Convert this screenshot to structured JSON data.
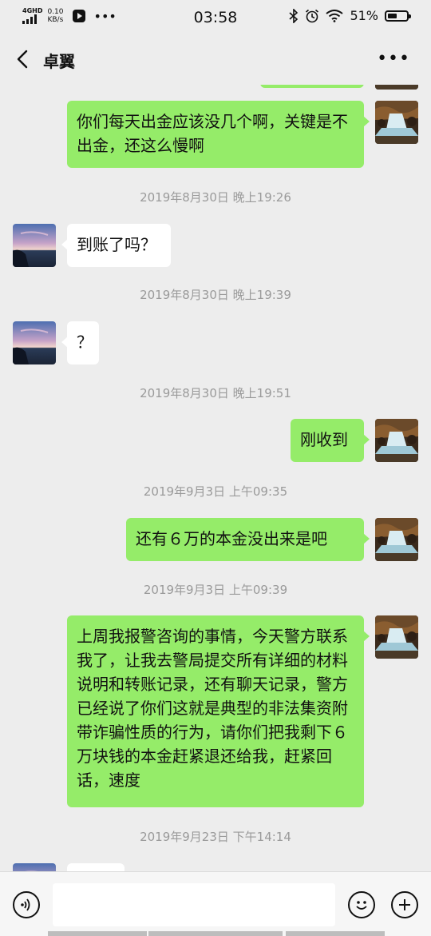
{
  "status_bar": {
    "network_tag": "4GHD",
    "speed_value": "0.10",
    "speed_unit": "KB/s",
    "time": "03:58",
    "battery_pct": "51%",
    "battery_level": 0.51
  },
  "header": {
    "title": "卓翼"
  },
  "messages": [
    {
      "sender": "me",
      "text": "你们每天出金应该没几个啊，关键是不出金，还这么慢啊"
    },
    {
      "timestamp": "2019年8月30日 晚上19:26"
    },
    {
      "sender": "them",
      "text": "到账了吗？"
    },
    {
      "timestamp": "2019年8月30日 晚上19:39"
    },
    {
      "sender": "them",
      "text": "？"
    },
    {
      "timestamp": "2019年8月30日 晚上19:51"
    },
    {
      "sender": "me",
      "text": "刚收到"
    },
    {
      "timestamp": "2019年9月3日 上午09:35"
    },
    {
      "sender": "me",
      "text": "还有６万的本金没出来是吧"
    },
    {
      "timestamp": "2019年9月3日 上午09:39"
    },
    {
      "sender": "me",
      "text": "上周我报警咨询的事情，今天警方联系我了，让我去警局提交所有详细的材料说明和转账记录，还有聊天记录，警方已经说了你们这就是典型的非法集资附带诈骗性质的行为，请你们把我剩下６万块钱的本金赶紧退还给我，赶紧回话，速度"
    },
    {
      "timestamp": "2019年9月23日 下午14:14"
    }
  ],
  "input_bar": {
    "voice_icon": "voice-icon",
    "emoji_icon": "emoji-icon",
    "plus_icon": "plus-icon"
  },
  "colors": {
    "background": "#ededed",
    "my_bubble": "#95ec69",
    "their_bubble": "#ffffff",
    "timestamp_text": "#9a9a9a"
  }
}
